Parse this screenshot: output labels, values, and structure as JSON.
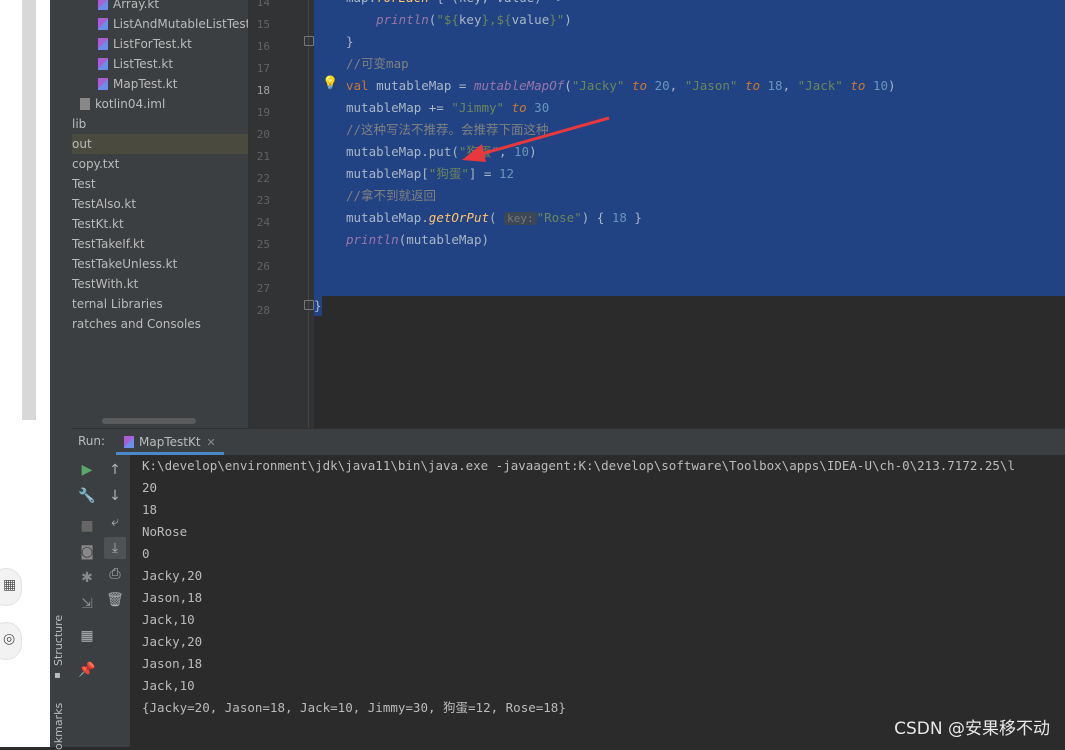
{
  "project_tree": {
    "items": [
      {
        "label": "Array.kt",
        "kind": "kotlin"
      },
      {
        "label": "ListAndMutableListTest.kt",
        "kind": "kotlin"
      },
      {
        "label": "ListForTest.kt",
        "kind": "kotlin"
      },
      {
        "label": "ListTest.kt",
        "kind": "kotlin"
      },
      {
        "label": "MapTest.kt",
        "kind": "kotlin"
      },
      {
        "label": "kotlin04.iml",
        "kind": "iml"
      },
      {
        "label": "lib",
        "kind": "folder"
      },
      {
        "label": "out",
        "kind": "folder",
        "selected": true
      },
      {
        "label": "copy.txt",
        "kind": "text"
      },
      {
        "label": "Test",
        "kind": "kotlin"
      },
      {
        "label": "TestAlso.kt",
        "kind": "kotlin"
      },
      {
        "label": "TestKt.kt",
        "kind": "kotlin"
      },
      {
        "label": "TestTakeIf.kt",
        "kind": "kotlin"
      },
      {
        "label": "TestTakeUnless.kt",
        "kind": "kotlin"
      },
      {
        "label": "TestWith.kt",
        "kind": "kotlin"
      },
      {
        "label": "ternal Libraries",
        "kind": "library"
      },
      {
        "label": "ratches and Consoles",
        "kind": "scratch"
      }
    ]
  },
  "editor": {
    "current_line": "18",
    "line_numbers": [
      "14",
      "15",
      "16",
      "17",
      "18",
      "19",
      "20",
      "21",
      "22",
      "23",
      "24",
      "25",
      "26",
      "27",
      "28"
    ],
    "param_hint": "key:"
  },
  "run_panel": {
    "label": "Run:",
    "tab_label": "MapTestKt",
    "command": "K:\\develop\\environment\\jdk\\java11\\bin\\java.exe -javaagent:K:\\develop\\software\\Toolbox\\apps\\IDEA-U\\ch-0\\213.7172.25\\l",
    "output_lines": [
      "20",
      "18",
      "NoRose",
      "0",
      "Jacky,20",
      "Jason,18",
      "Jack,10",
      "Jacky,20",
      "Jason,18",
      "Jack,10",
      "{Jacky=20, Jason=18, Jack=10, Jimmy=30, 狗蛋=12, Rose=18}"
    ]
  },
  "side_tabs": {
    "structure": "Structure",
    "bookmarks": "okmarks"
  },
  "watermark": "CSDN @安果移不动",
  "colors": {
    "selection": "#214283",
    "keyword": "#cc7832",
    "string": "#6a8759",
    "number": "#6897bb",
    "comment": "#808080",
    "function": "#ffc66d",
    "annotation_arrow": "#e8383d"
  }
}
